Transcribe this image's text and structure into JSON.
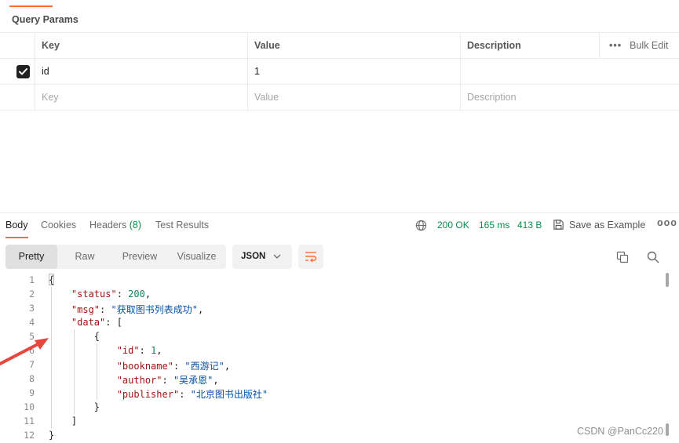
{
  "params": {
    "tab_label": "Query Params",
    "headers": {
      "key": "Key",
      "value": "Value",
      "description": "Description",
      "bulk_edit": "Bulk Edit",
      "more": "•••"
    },
    "rows": [
      {
        "checked": true,
        "key": "id",
        "value": "1",
        "description": ""
      }
    ],
    "placeholder": {
      "key": "Key",
      "value": "Value",
      "description": "Description"
    }
  },
  "response": {
    "tabs": [
      {
        "label": "Body",
        "active": true
      },
      {
        "label": "Cookies"
      },
      {
        "label": "Headers",
        "count": "(8)"
      },
      {
        "label": "Test Results"
      }
    ],
    "status": "200 OK",
    "time": "165 ms",
    "size": "413 B",
    "save_label": "Save as Example",
    "more": "ooo",
    "views": [
      "Pretty",
      "Raw",
      "Preview",
      "Visualize"
    ],
    "selected_view": "Pretty",
    "format": "JSON"
  },
  "code": {
    "line_numbers": [
      "1",
      "2",
      "3",
      "4",
      "5",
      "6",
      "7",
      "8",
      "9",
      "10",
      "11",
      "12"
    ],
    "lines": [
      "{",
      "    \"status\": 200,",
      "    \"msg\": \"获取图书列表成功\",",
      "    \"data\": [",
      "        {",
      "            \"id\": 1,",
      "            \"bookname\": \"西游记\",",
      "            \"author\": \"吴承恩\",",
      "            \"publisher\": \"北京图书出版社\"",
      "        }",
      "    ]",
      "}"
    ]
  },
  "watermark": "CSDN @PanCc220",
  "colors": {
    "accent": "#ff6c37",
    "status_ok": "#0a8c4e",
    "arrow": "#e8453c"
  }
}
